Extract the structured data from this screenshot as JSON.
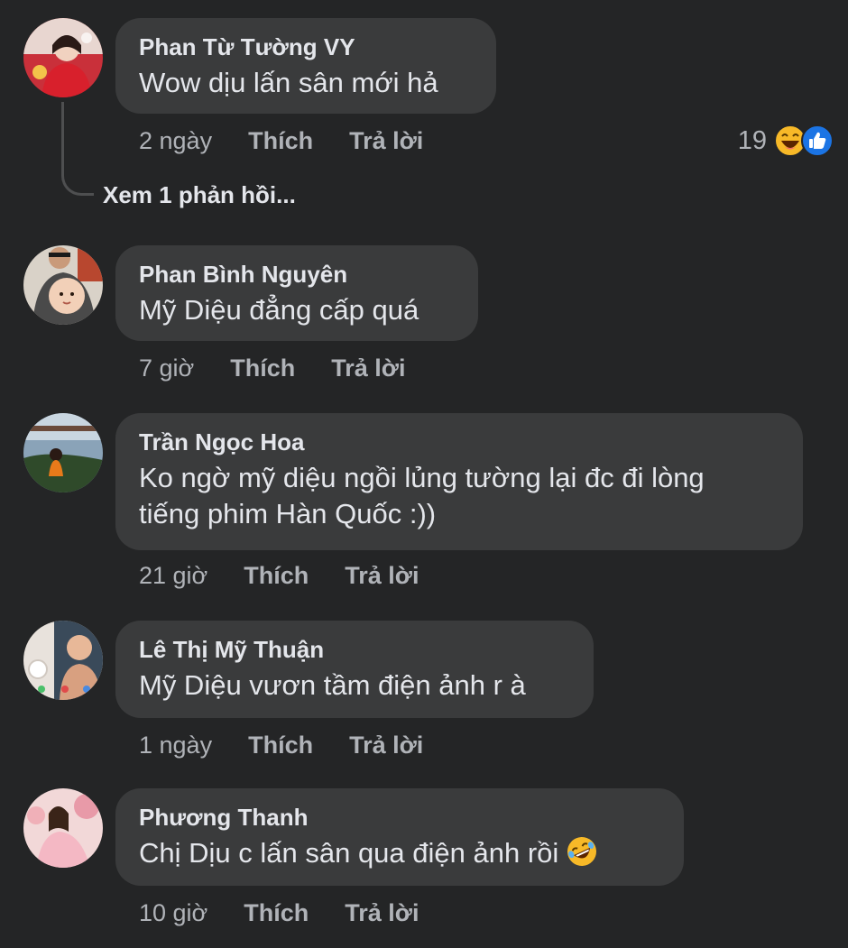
{
  "comments": [
    {
      "author": "Phan Từ Tường VY",
      "text": "Wow dịu lấn sân mới hả",
      "time": "2 ngày",
      "like_label": "Thích",
      "reply_label": "Trả lời",
      "reaction_count": "19",
      "reaction_icons": [
        "laugh-reaction-icon",
        "like-reaction-icon"
      ],
      "view_replies": "Xem 1 phản hồi..."
    },
    {
      "author": "Phan Bình Nguyên",
      "text": "Mỹ Diệu đẳng cấp quá",
      "time": "7 giờ",
      "like_label": "Thích",
      "reply_label": "Trả lời"
    },
    {
      "author": "Trần Ngọc Hoa",
      "text_line1": "Ko ngờ mỹ diệu ngồi lủng tường lại đc đi lòng",
      "text_line2": "tiếng phim Hàn Quốc :))",
      "time": "21 giờ",
      "like_label": "Thích",
      "reply_label": "Trả lời"
    },
    {
      "author": "Lê Thị Mỹ Thuận",
      "text": "Mỹ Diệu vươn tầm điện ảnh r à",
      "time": "1 ngày",
      "like_label": "Thích",
      "reply_label": "Trả lời"
    },
    {
      "author": "Phương Thanh",
      "text": "Chị Dịu c lấn sân qua điện ảnh rồi",
      "emoji": "rofl-emoji-icon",
      "time": "10 giờ",
      "like_label": "Thích",
      "reply_label": "Trả lời"
    }
  ],
  "colors": {
    "background": "#242526",
    "bubble": "#3a3b3c",
    "primary_text": "#e4e6eb",
    "secondary_text": "#b0b3b8",
    "like_blue": "#1b74e4",
    "haha_yellow": "#f7b928"
  }
}
